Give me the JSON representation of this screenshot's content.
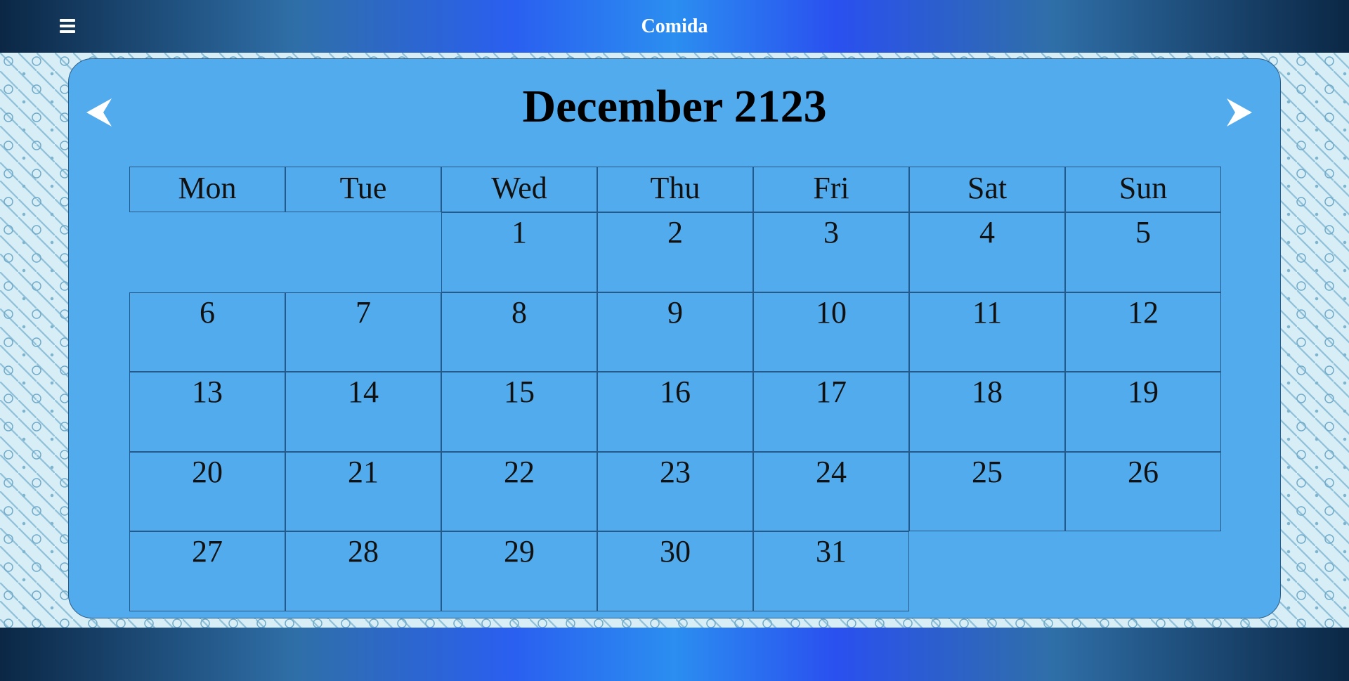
{
  "app": {
    "title": "Comida"
  },
  "calendar": {
    "month_title": "December 2123",
    "weekdays": [
      "Mon",
      "Tue",
      "Wed",
      "Thu",
      "Fri",
      "Sat",
      "Sun"
    ],
    "weeks": [
      [
        "",
        "",
        "1",
        "2",
        "3",
        "4",
        "5"
      ],
      [
        "6",
        "7",
        "8",
        "9",
        "10",
        "11",
        "12"
      ],
      [
        "13",
        "14",
        "15",
        "16",
        "17",
        "18",
        "19"
      ],
      [
        "20",
        "21",
        "22",
        "23",
        "24",
        "25",
        "26"
      ],
      [
        "27",
        "28",
        "29",
        "30",
        "31",
        "",
        ""
      ]
    ]
  },
  "icons": {
    "menu": "hamburger-menu-icon",
    "prev": "left-arrow-icon",
    "next": "right-arrow-icon"
  },
  "colors": {
    "panel": "#52abec",
    "header_gradient_center": "#2b8ef0",
    "border": "#24598a"
  }
}
